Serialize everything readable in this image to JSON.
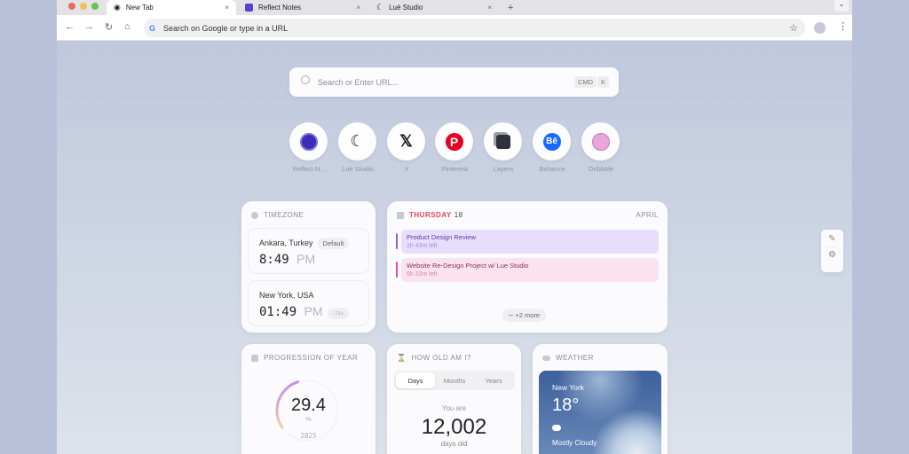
{
  "browser": {
    "tabs": [
      {
        "label": "New Tab",
        "active": true
      },
      {
        "label": "Reflect Notes"
      },
      {
        "label": "Lué Studio"
      }
    ],
    "address_placeholder": "Search on Google or type in a URL",
    "new_tab": "+",
    "close": "×"
  },
  "search": {
    "placeholder": "Search or Enter URL...",
    "kbd": [
      "CMD",
      "K"
    ]
  },
  "shortcuts": [
    {
      "label": "Reflect N...",
      "icon": "reflect-icon",
      "color": "#3b2db5"
    },
    {
      "label": "Lué Studio",
      "icon": "moon-icon",
      "color": "#222222"
    },
    {
      "label": "X",
      "icon": "x-icon",
      "color": "#111111"
    },
    {
      "label": "Pinterest",
      "icon": "pinterest-icon",
      "color": "#e60023"
    },
    {
      "label": "Layers",
      "icon": "layers-icon",
      "color": "#333333"
    },
    {
      "label": "Behance",
      "icon": "behance-icon",
      "color": "#1769ff"
    },
    {
      "label": "Dribbble",
      "icon": "dribbble-icon",
      "color": "#d58ac6"
    }
  ],
  "timezone": {
    "title": "TIMEZONE",
    "zones": [
      {
        "city": "Ankara, Turkey",
        "badge": "Default",
        "time": "8:49",
        "ampm": "PM"
      },
      {
        "city": "New York, USA",
        "badge": "-7H",
        "time": "01:49",
        "ampm": "PM"
      }
    ]
  },
  "calendar": {
    "day": "THURSDAY",
    "date": "18",
    "month": "APRIL",
    "events": [
      {
        "title": "Product Design Review",
        "left": "1h 43m left",
        "color": "#8b5cf6"
      },
      {
        "title": "Website Re-Design Project w/ Lue Studio",
        "left": "6h 33m left",
        "color": "#ec4899"
      }
    ],
    "more": "+2 more"
  },
  "progress": {
    "title": "PROGRESSION OF YEAR",
    "value": "29.4",
    "unit": "%",
    "year": "2025",
    "fraction": 0.294
  },
  "age": {
    "title": "HOW OLD AM I?",
    "tabs": [
      "Days",
      "Months",
      "Years"
    ],
    "prefix": "You are",
    "value": "12,002",
    "suffix": "days old"
  },
  "weather": {
    "title": "WEATHER",
    "city": "New York",
    "temp": "18°",
    "condition": "Mostly Cloudy"
  }
}
